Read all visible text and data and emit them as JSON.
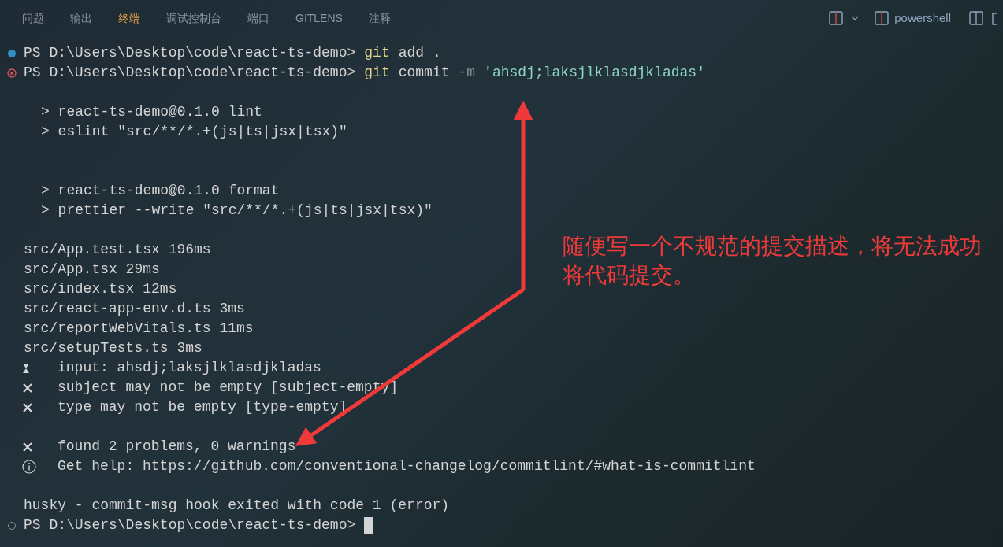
{
  "tabs": [
    {
      "label": "问题",
      "selected": false
    },
    {
      "label": "输出",
      "selected": false
    },
    {
      "label": "终端",
      "selected": true
    },
    {
      "label": "调试控制台",
      "selected": false
    },
    {
      "label": "端口",
      "selected": false
    },
    {
      "label": "GITLENS",
      "selected": false
    },
    {
      "label": "注释",
      "selected": false
    }
  ],
  "terminal_name": "powershell",
  "lines": [
    {
      "kind": "command_success",
      "prompt": "PS D:\\Users\\Desktop\\code\\react-ts-demo>",
      "tokens": [
        {
          "kind": "program",
          "text": "git"
        },
        {
          "kind": "arg",
          "text": "add"
        },
        {
          "kind": "arg",
          "text": "."
        }
      ]
    },
    {
      "kind": "command_error",
      "prompt": "PS D:\\Users\\Desktop\\code\\react-ts-demo>",
      "tokens": [
        {
          "kind": "program",
          "text": "git"
        },
        {
          "kind": "arg",
          "text": "commit"
        },
        {
          "kind": "flag",
          "text": "-m"
        },
        {
          "kind": "string",
          "text": "'ahsdj;laksjlklasdjkladas'"
        }
      ]
    },
    {
      "kind": "blank"
    },
    {
      "kind": "script",
      "text": "> react-ts-demo@0.1.0 lint"
    },
    {
      "kind": "script",
      "text": "> eslint \"src/**/*.+(js|ts|jsx|tsx)\""
    },
    {
      "kind": "blank"
    },
    {
      "kind": "blank"
    },
    {
      "kind": "script",
      "text": "> react-ts-demo@0.1.0 format"
    },
    {
      "kind": "script",
      "text": "> prettier --write \"src/**/*.+(js|ts|jsx|tsx)\""
    },
    {
      "kind": "blank"
    },
    {
      "kind": "text",
      "text": "src/App.test.tsx 196ms"
    },
    {
      "kind": "text",
      "text": "src/App.tsx 29ms"
    },
    {
      "kind": "text",
      "text": "src/index.tsx 12ms"
    },
    {
      "kind": "text",
      "text": "src/react-app-env.d.ts 3ms"
    },
    {
      "kind": "text",
      "text": "src/reportWebVitals.ts 11ms"
    },
    {
      "kind": "text",
      "text": "src/setupTests.ts 3ms"
    },
    {
      "kind": "lint_input",
      "text": "input: ahsdj;laksjlklasdjkladas"
    },
    {
      "kind": "lint_error",
      "text": "subject may not be empty [subject-empty]"
    },
    {
      "kind": "lint_error",
      "text": "type may not be empty [type-empty]"
    },
    {
      "kind": "blank"
    },
    {
      "kind": "lint_error",
      "text": "found 2 problems, 0 warnings"
    },
    {
      "kind": "lint_info",
      "text": "Get help: https://github.com/conventional-changelog/commitlint/#what-is-commitlint"
    },
    {
      "kind": "blank"
    },
    {
      "kind": "text",
      "text": "husky - commit-msg hook exited with code 1 (error)"
    },
    {
      "kind": "command_idle",
      "prompt": "PS D:\\Users\\Desktop\\code\\react-ts-demo>",
      "cursor": true
    }
  ],
  "annotation": {
    "text": "随便写一个不规范的提交描述，将无法成功将代码提交。"
  }
}
